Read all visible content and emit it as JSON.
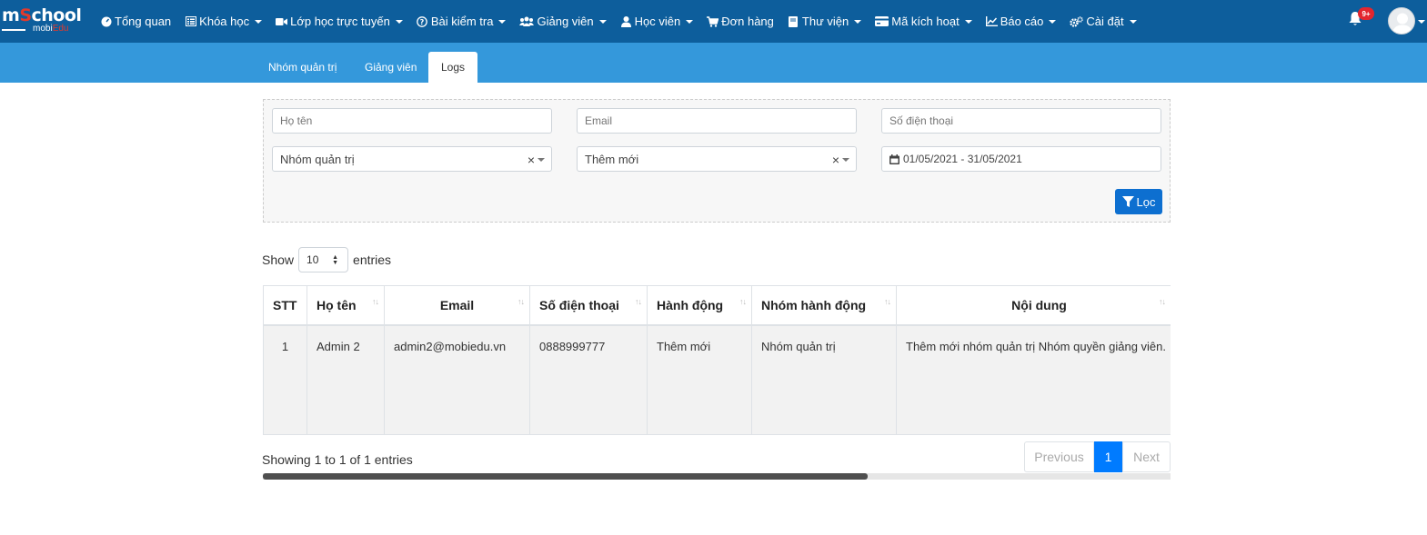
{
  "brand": {
    "logo_text_1": "m",
    "logo_text_2": "S",
    "logo_text_3": "chool",
    "logo_sub_1": "mobi",
    "logo_sub_2": "Edu"
  },
  "nav": [
    {
      "label": "Tổng quan",
      "icon": "dashboard-icon",
      "dropdown": false
    },
    {
      "label": "Khóa học",
      "icon": "list-icon",
      "dropdown": true
    },
    {
      "label": "Lớp học trực tuyến",
      "icon": "video-icon",
      "dropdown": true
    },
    {
      "label": "Bài kiểm tra",
      "icon": "question-icon",
      "dropdown": true
    },
    {
      "label": "Giảng viên",
      "icon": "users-icon",
      "dropdown": true
    },
    {
      "label": "Học viên",
      "icon": "user-icon",
      "dropdown": true
    },
    {
      "label": "Đơn hàng",
      "icon": "cart-icon",
      "dropdown": false
    },
    {
      "label": "Thư viện",
      "icon": "book-icon",
      "dropdown": true
    },
    {
      "label": "Mã kích hoạt",
      "icon": "card-icon",
      "dropdown": true
    },
    {
      "label": "Báo cáo",
      "icon": "chart-icon",
      "dropdown": true
    },
    {
      "label": "Cài đặt",
      "icon": "cogs-icon",
      "dropdown": true
    }
  ],
  "notifications": {
    "badge": "9+"
  },
  "subtabs": [
    {
      "label": "Nhóm quản trị",
      "active": false
    },
    {
      "label": "Giảng viên",
      "active": false
    },
    {
      "label": "Logs",
      "active": true
    }
  ],
  "filter": {
    "name_placeholder": "Họ tên",
    "email_placeholder": "Email",
    "phone_placeholder": "Số điện thoại",
    "group_value": "Nhóm quản trị",
    "action_value": "Thêm mới",
    "date_range": "01/05/2021 - 31/05/2021",
    "filter_button": "Lọc"
  },
  "length": {
    "show": "Show",
    "value": "10",
    "entries": "entries"
  },
  "table": {
    "headers": [
      "STT",
      "Họ tên",
      "Email",
      "Số điện thoại",
      "Hành động",
      "Nhóm hành động",
      "Nội dung"
    ],
    "rows": [
      [
        "1",
        "Admin 2",
        "admin2@mobiedu.vn",
        "0888999777",
        "Thêm mới",
        "Nhóm quản trị",
        "Thêm mới nhóm quản trị Nhóm quyền giảng viên."
      ]
    ]
  },
  "info": "Showing 1 to 1 of 1 entries",
  "pagination": {
    "previous": "Previous",
    "current": "1",
    "next": "Next"
  }
}
